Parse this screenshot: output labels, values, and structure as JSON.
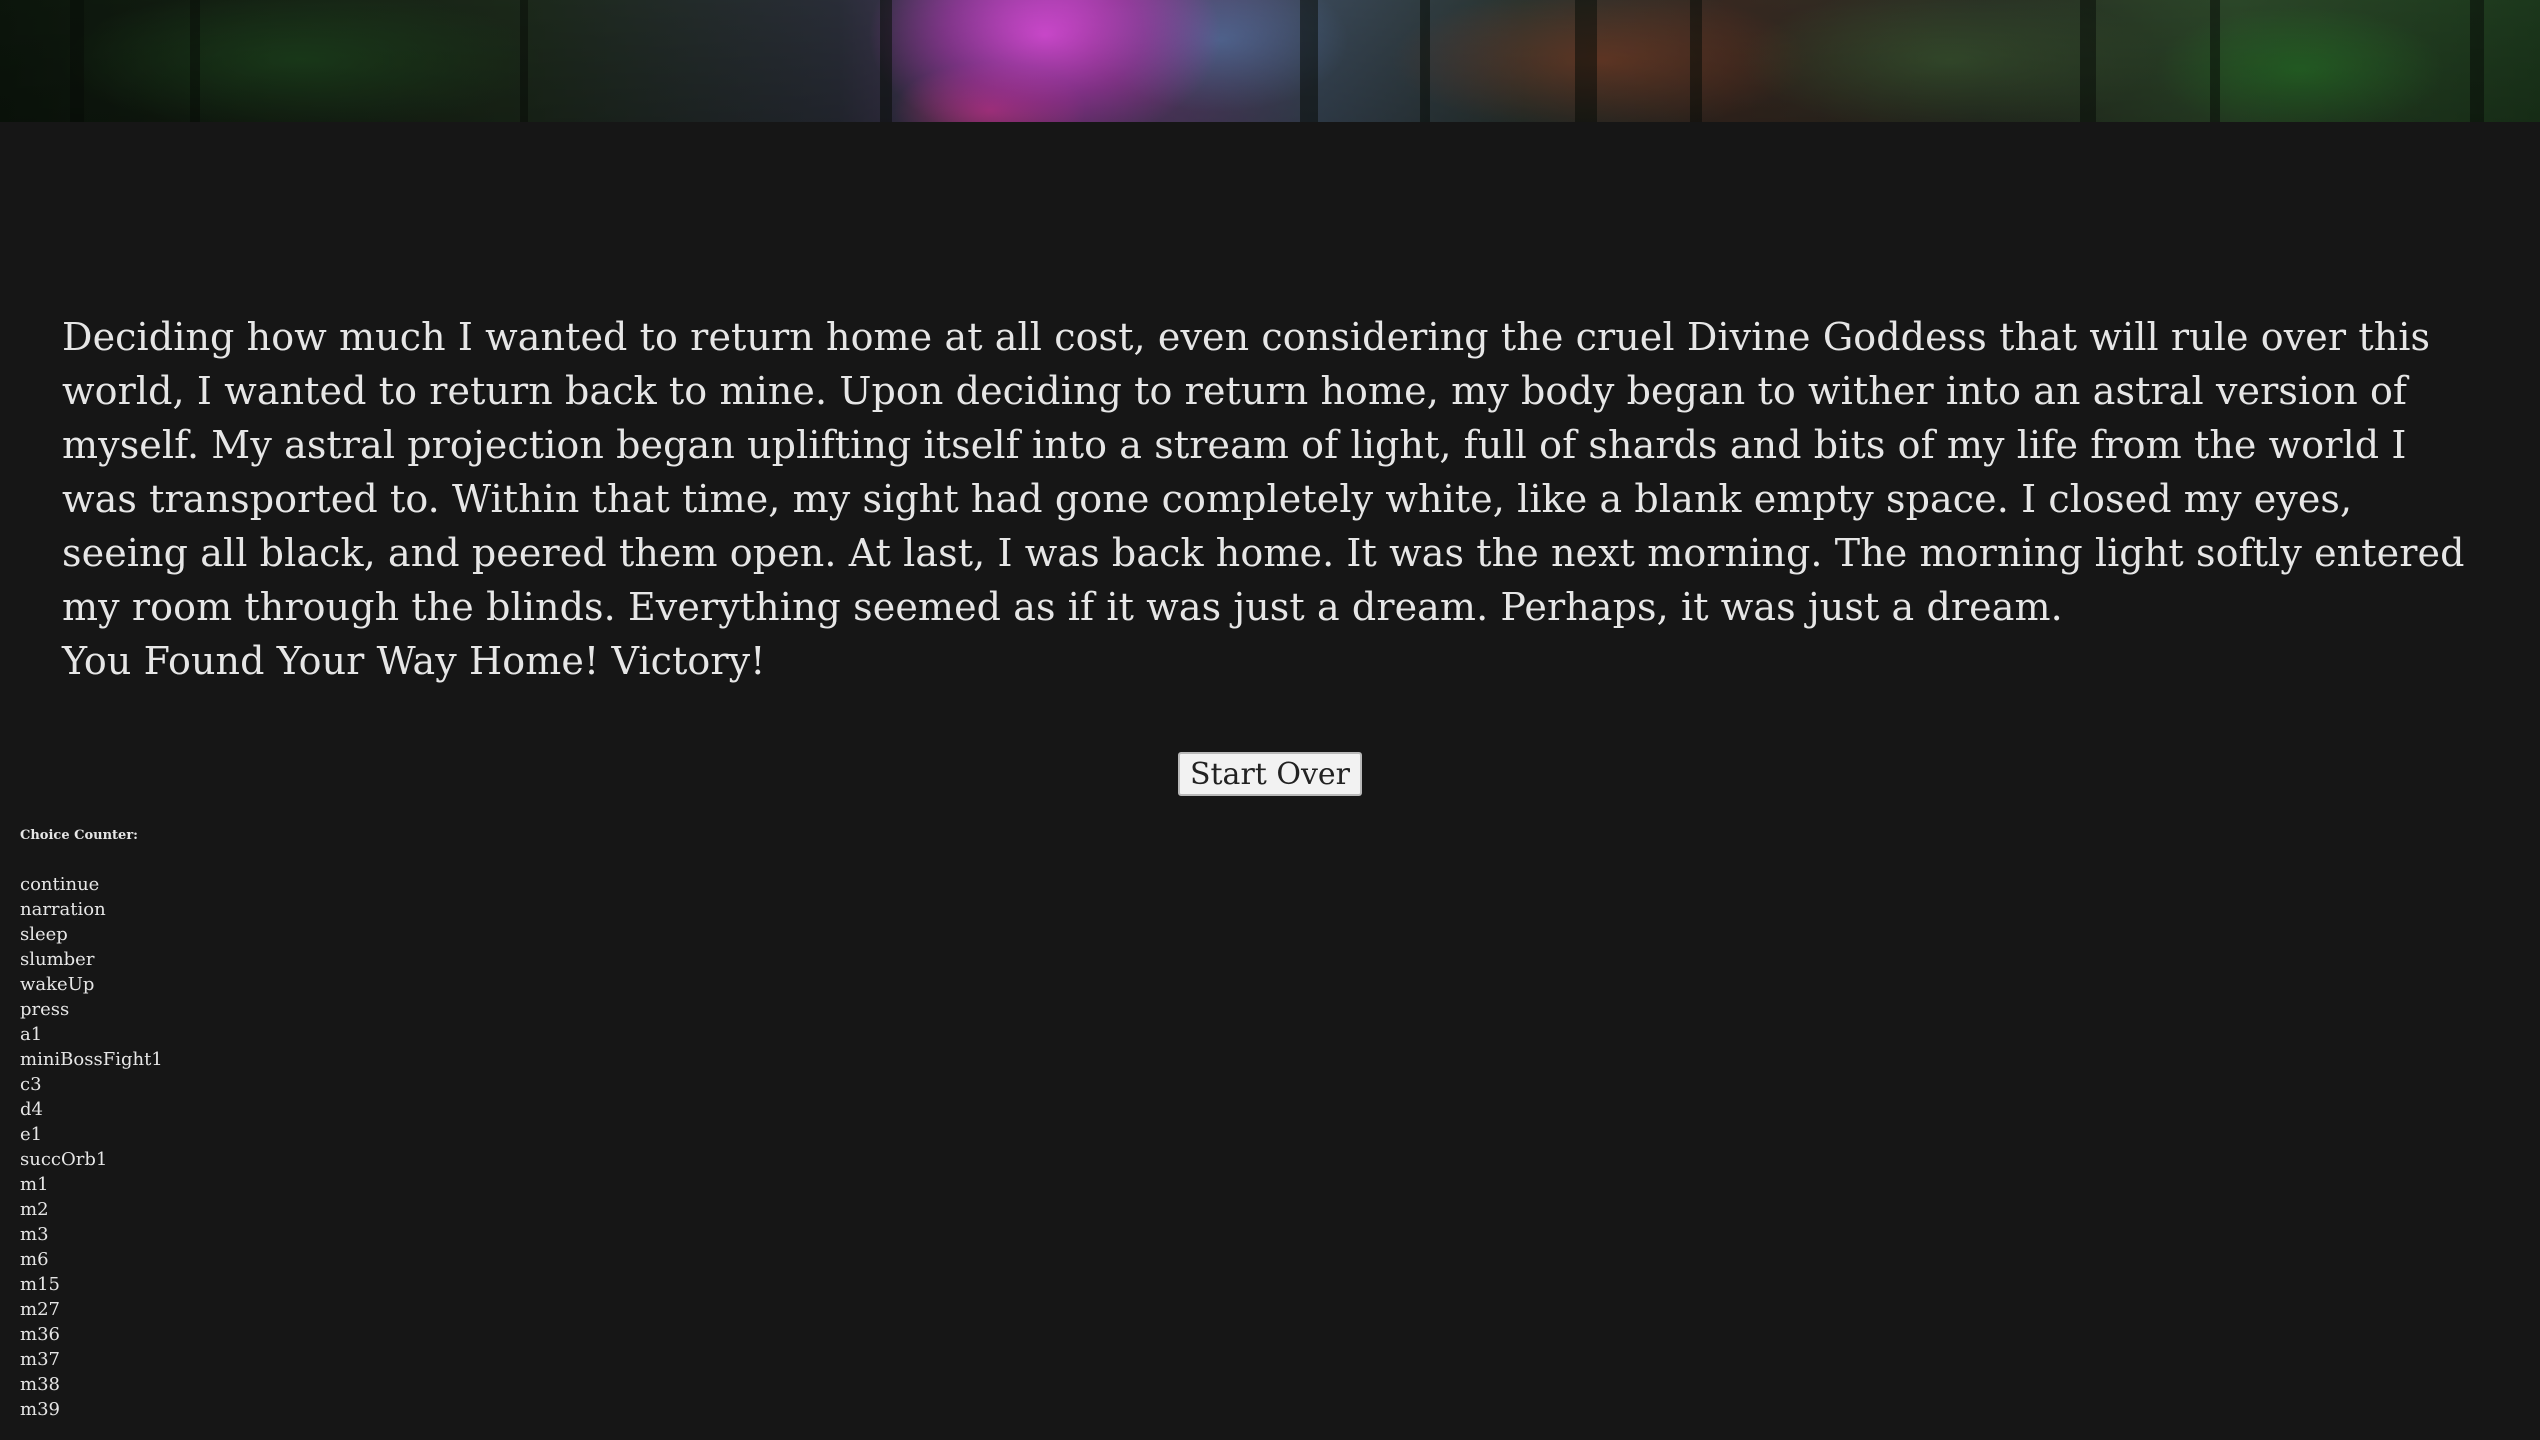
{
  "banner": {
    "image_name": "magical-forest-banner"
  },
  "story": {
    "paragraph": "Deciding how much I wanted to return home at all cost, even considering the cruel Divine Goddess that will rule over this world, I wanted to return back to mine. Upon deciding to return home, my body began to wither into an astral version of myself. My astral projection began uplifting itself into a stream of light, full of shards and bits of my life from the world I was transported to. Within that time, my sight had gone completely white, like a blank empty space. I closed my eyes, seeing all black, and peered them open. At last, I was back home. It was the next morning. The morning light softly entered my room through the blinds. Everything seemed as if it was just a dream. Perhaps, it was just a dream.",
    "ending": "You Found Your Way Home! Victory!"
  },
  "actions": {
    "start_over_label": "Start Over"
  },
  "counter": {
    "title": "Choice Counter:",
    "items": [
      "continue",
      "narration",
      "sleep",
      "slumber",
      "wakeUp",
      "press",
      "a1",
      "miniBossFight1",
      "c3",
      "d4",
      "e1",
      "succOrb1",
      "m1",
      "m2",
      "m3",
      "m6",
      "m15",
      "m27",
      "m36",
      "m37",
      "m38",
      "m39"
    ]
  }
}
